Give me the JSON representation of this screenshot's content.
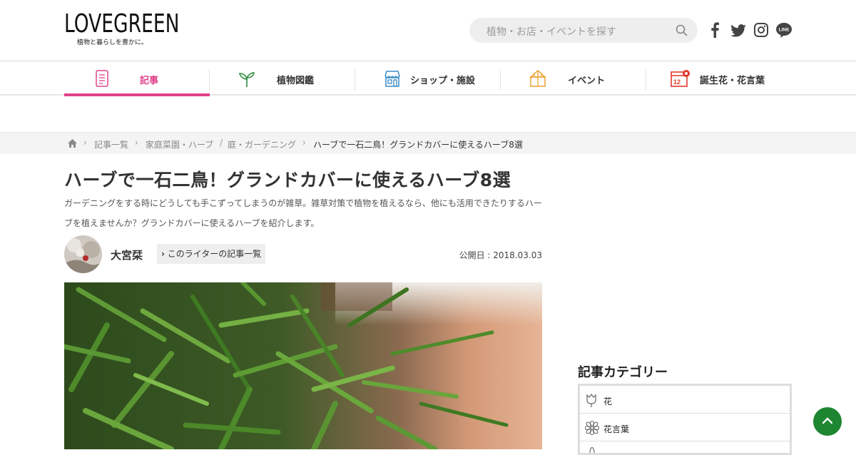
{
  "header": {
    "logo": "LOVEGREEN",
    "tagline": "植物と暮らしを豊かに。",
    "search_placeholder": "植物・お店・イベントを探す",
    "social": [
      "facebook-icon",
      "twitter-icon",
      "instagram-icon",
      "line-icon"
    ],
    "line_label": "LINE"
  },
  "nav": {
    "items": [
      {
        "label": "記事",
        "icon": "article-icon",
        "active": true
      },
      {
        "label": "植物図鑑",
        "icon": "sprout-icon",
        "active": false
      },
      {
        "label": "ショップ・施設",
        "icon": "shop-icon",
        "active": false
      },
      {
        "label": "イベント",
        "icon": "tent-icon",
        "active": false
      },
      {
        "label": "誕生花・花言葉",
        "icon": "calendar-icon",
        "active": false
      }
    ],
    "accent": "#e0428b"
  },
  "breadcrumb": {
    "home": "home-icon",
    "items": [
      "記事一覧",
      "家庭菜園・ハーブ",
      "庭・ガーデニング"
    ],
    "current": "ハーブで一石二鳥！グランドカバーに使えるハーブ8選"
  },
  "article": {
    "title": "ハーブで一石二鳥！グランドカバーに使えるハーブ8選",
    "lead": "ガーデニングをする時にどうしても手こずってしまうのが雑草。雑草対策で植物を植えるなら、他にも活用できたりするハーブを植えませんか？グランドカバーに使えるハーブを紹介します。",
    "author": "大宮栞",
    "author_link": "このライターの記事一覧",
    "published": "公開日 : 2018.03.03"
  },
  "sidebar": {
    "title": "記事カテゴリー",
    "categories": [
      {
        "label": "花",
        "icon": "tulip-icon"
      },
      {
        "label": "花言葉",
        "icon": "flower-icon"
      }
    ]
  },
  "colors": {
    "accent": "#e0428b",
    "green": "#1e8531"
  }
}
